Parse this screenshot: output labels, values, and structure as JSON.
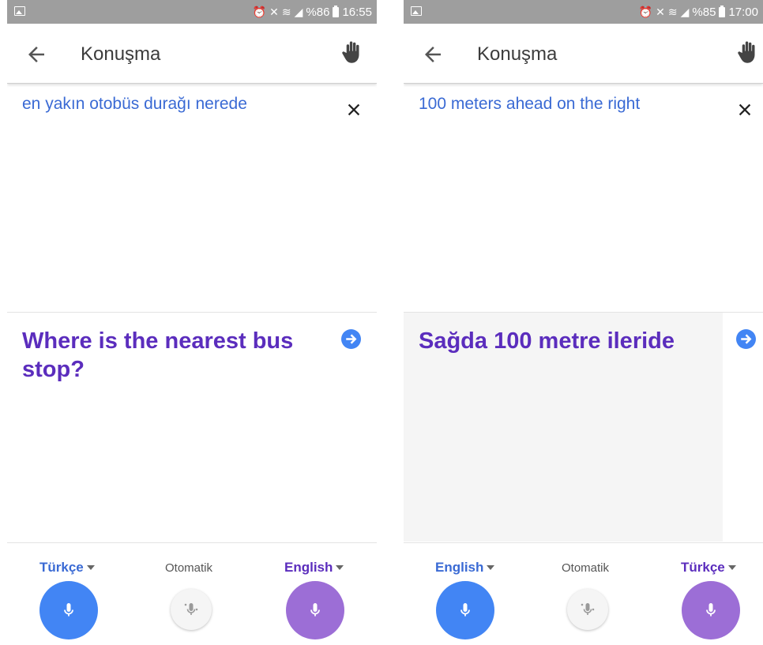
{
  "colors": {
    "status_bar": "#9e9e9e",
    "source_text": "#3a6ad4",
    "translation_text": "#5b2dbd",
    "mic_left": "#4285f4",
    "mic_right": "#9c6ed6",
    "arrow_button": "#4285f4",
    "result_panel_highlight": "#f5f5f5"
  },
  "screens": [
    {
      "status": {
        "battery_percent": "%86",
        "time": "16:55"
      },
      "title": "Konuşma",
      "source_text": "en yakın otobüs durağı nerede",
      "translation": "Where is the nearest bus stop?",
      "languages": {
        "left": "Türkçe",
        "auto": "Otomatik",
        "right": "English"
      }
    },
    {
      "status": {
        "battery_percent": "%85",
        "time": "17:00"
      },
      "title": "Konuşma",
      "source_text": "100 meters ahead on the right",
      "translation": "Sağda 100 metre ileride",
      "languages": {
        "left": "English",
        "auto": "Otomatik",
        "right": "Türkçe"
      }
    }
  ]
}
